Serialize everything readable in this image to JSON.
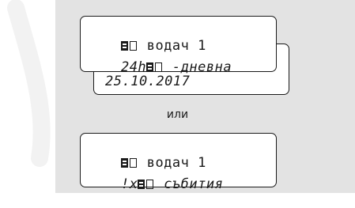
{
  "screen1": {
    "line1": "водач 1",
    "line2_prefix": "24h",
    "line2_suffix": "-дневна",
    "date": "25.10.2017"
  },
  "separator": "или",
  "screen2": {
    "line1": "водач 1",
    "line2_prefix": "!x",
    "line2_suffix": "събития"
  },
  "icons": {
    "card": "driver-card-icon",
    "slot": "card-slot-icon"
  },
  "colors": {
    "panel_bg": "#e3e3e3",
    "ink": "#1a1a1a"
  }
}
